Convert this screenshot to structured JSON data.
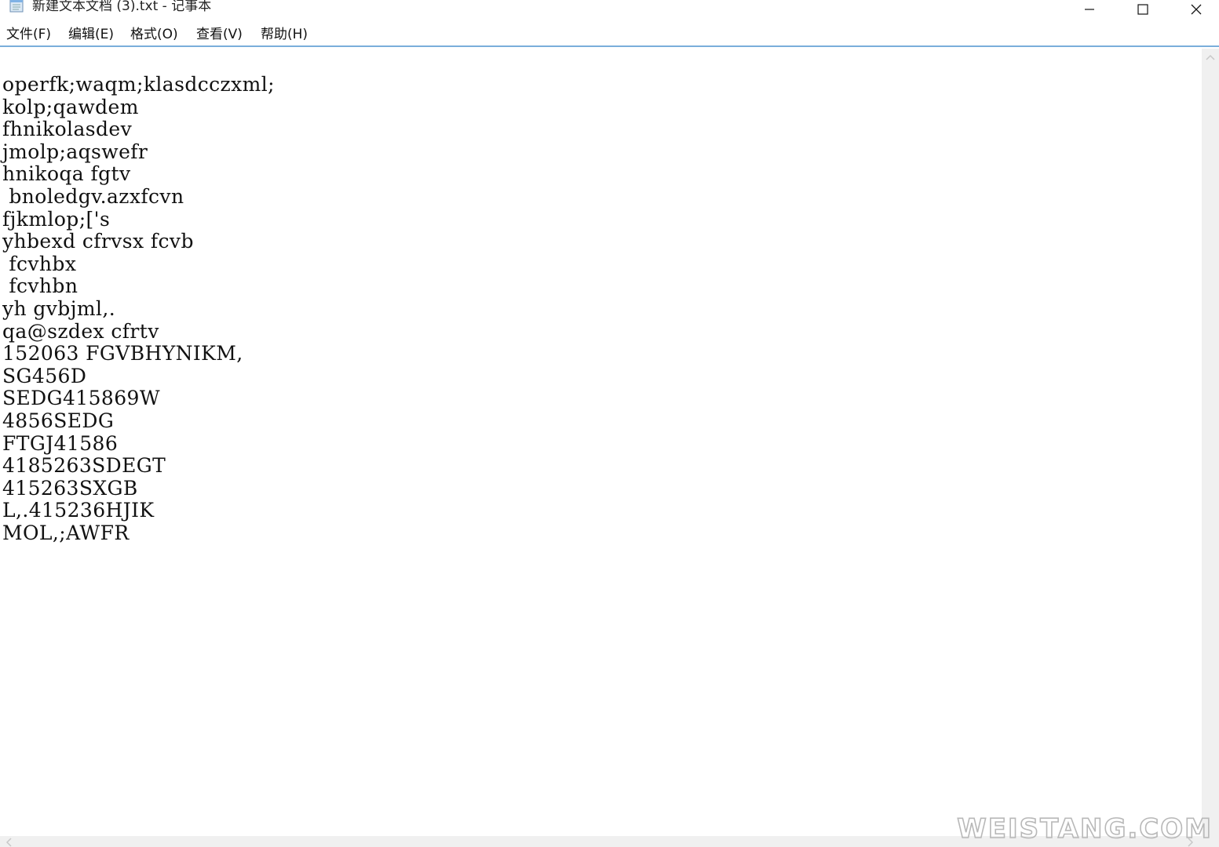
{
  "window": {
    "title": "新建文本文档 (3).txt - 记事本",
    "icon": "notepad-icon",
    "controls": [
      "minimize-icon",
      "maximize-icon",
      "close-icon"
    ]
  },
  "menu": {
    "file": "文件(F)",
    "edit": "编辑(E)",
    "format": "格式(O)",
    "view": "查看(V)",
    "help": "帮助(H)"
  },
  "editor": {
    "lines": [
      "operfk;waqm;klasdcczxml;",
      "kolp;qawdem",
      "fhnikolasdev",
      "jmolp;aqswefr",
      "hnikoqa fgtv",
      " bnoledgv.azxfcvn",
      "fjkmlop;['s",
      "yhbexd cfrvsx fcvb",
      " fcvhbx",
      " fcvhbn",
      "yh gvbjml,.",
      "qa@szdex cfrtv",
      "152063 FGVBHYNIKM,",
      "SG456D",
      "SEDG415869W",
      "4856SEDG",
      "FTGJ41586",
      "4185263SDEGT",
      "415263SXGB",
      "L,.415236HJIK",
      "MOL,;AWFR"
    ]
  },
  "watermark": {
    "text": "WEISTANG.COM",
    "color": "#b8b8b8"
  },
  "colors": {
    "menu_border": "#7aaedb",
    "scrollbar": "#f0f0f0"
  }
}
